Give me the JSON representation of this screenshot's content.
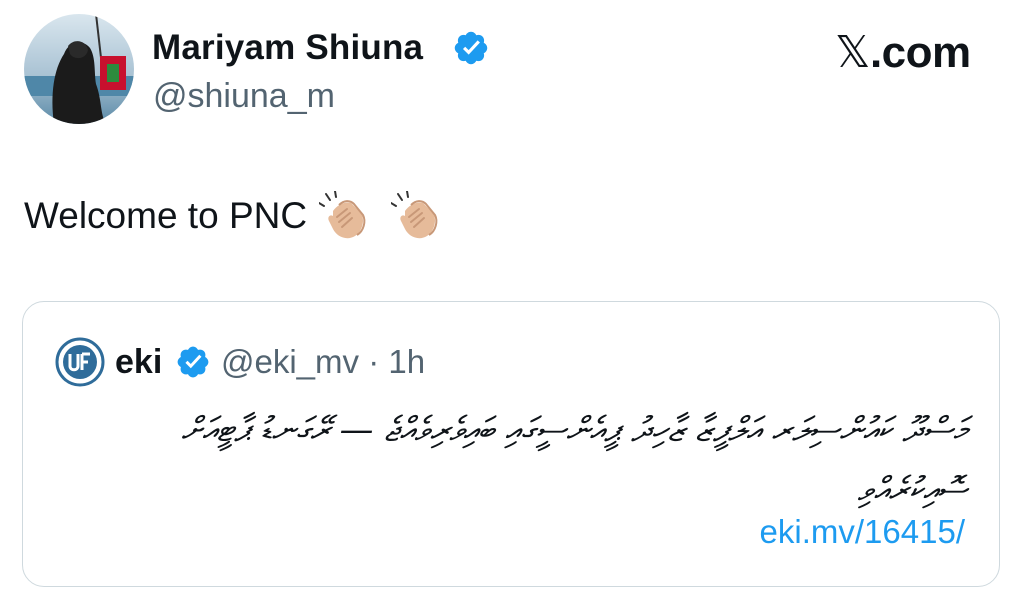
{
  "author": {
    "name": "Mariyam Shiuna",
    "handle": "@shiuna_m",
    "verified_icon": "verified-badge"
  },
  "brand": {
    "logo_glyph": "𝕏",
    "logo_suffix": ".com"
  },
  "tweet": {
    "text": "Welcome to PNC",
    "emoji": [
      "clapping-hands-light-skin",
      "clapping-hands-light-skin"
    ]
  },
  "quote": {
    "name": "eki",
    "handle_time": "@eki_mv · 1h",
    "verified_icon": "verified-badge",
    "body": "މަސްދޫ ކައުންސިލަރ އަލްފީޒާ ޒާހިދު ޕީއެންސީގައި ބައިވެރިވެއްޖެ — ރޭގަނޑު ޕާޓީއަށް ސޮއިކުރެއްވި",
    "link": "eki.mv/16415/"
  },
  "colors": {
    "text": "#0f1419",
    "secondary": "#536471",
    "link": "#1d9bf0",
    "verified": "#1d9bf0",
    "border": "#cfd9de"
  }
}
